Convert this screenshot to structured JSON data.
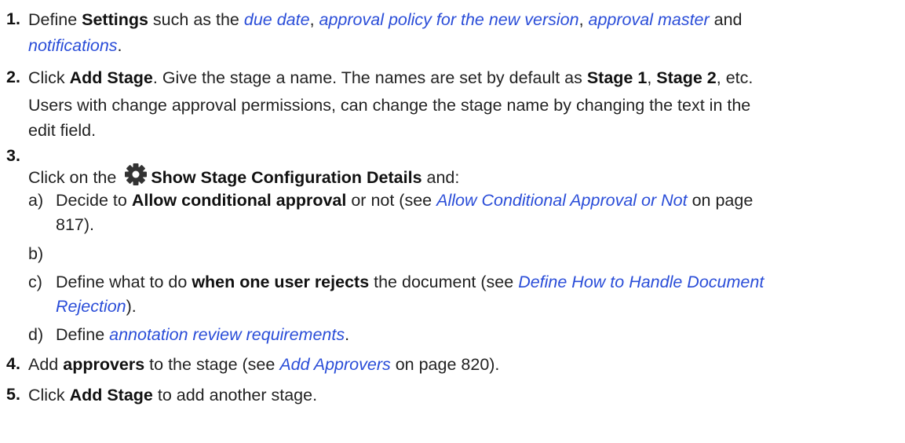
{
  "steps": [
    {
      "num": "1.",
      "t1": "Define ",
      "b1": "Settings",
      "t2": " such as the ",
      "l1": "due date",
      "t3": ", ",
      "l2": "approval policy for the new version",
      "t4": ", ",
      "l3": "approval master",
      "t5": " and",
      "l4": "notifications",
      "t6": "."
    },
    {
      "num": "2.",
      "t1": "Click ",
      "b1": "Add Stage",
      "t2": ". Give the stage a name. The names are set by default as ",
      "b2": "Stage 1",
      "t3": ", ",
      "b3": "Stage 2",
      "t4": ", etc.",
      "p2a": "Users with change approval permissions, can change the stage name by changing the text in the",
      "p2b": "edit field."
    },
    {
      "num": "3.",
      "t1": "Click on the ",
      "icon": "gear-icon",
      "b1": "Show Stage Configuration Details",
      "t2": " and:",
      "sub": [
        {
          "letter": "a)",
          "t1": "Decide to ",
          "b1": "Allow conditional approval",
          "t2": " or not (see ",
          "l1": "Allow Conditional Approval or Not",
          "t3": " on page",
          "t4": "817)."
        },
        {
          "letter": "b)"
        },
        {
          "letter": "c)",
          "t1": "Define what to do ",
          "b1": "when one user rejects",
          "t2": " the document (see ",
          "l1": "Define How to Handle Document",
          "l2": "Rejection",
          "t3": ")."
        },
        {
          "letter": "d)",
          "t1": "Define ",
          "l1": "annotation review requirements",
          "t2": "."
        }
      ]
    },
    {
      "num": "4.",
      "t1": "Add ",
      "b1": "approvers",
      "t2": " to the stage (see ",
      "l1": "Add Approvers",
      "t3": " on page 820)."
    },
    {
      "num": "5.",
      "t1": "Click ",
      "b1": "Add Stage",
      "t2": " to add another stage."
    }
  ],
  "colors": {
    "text": "#222222",
    "link": "#2a4dd8",
    "icon": "#333333"
  }
}
